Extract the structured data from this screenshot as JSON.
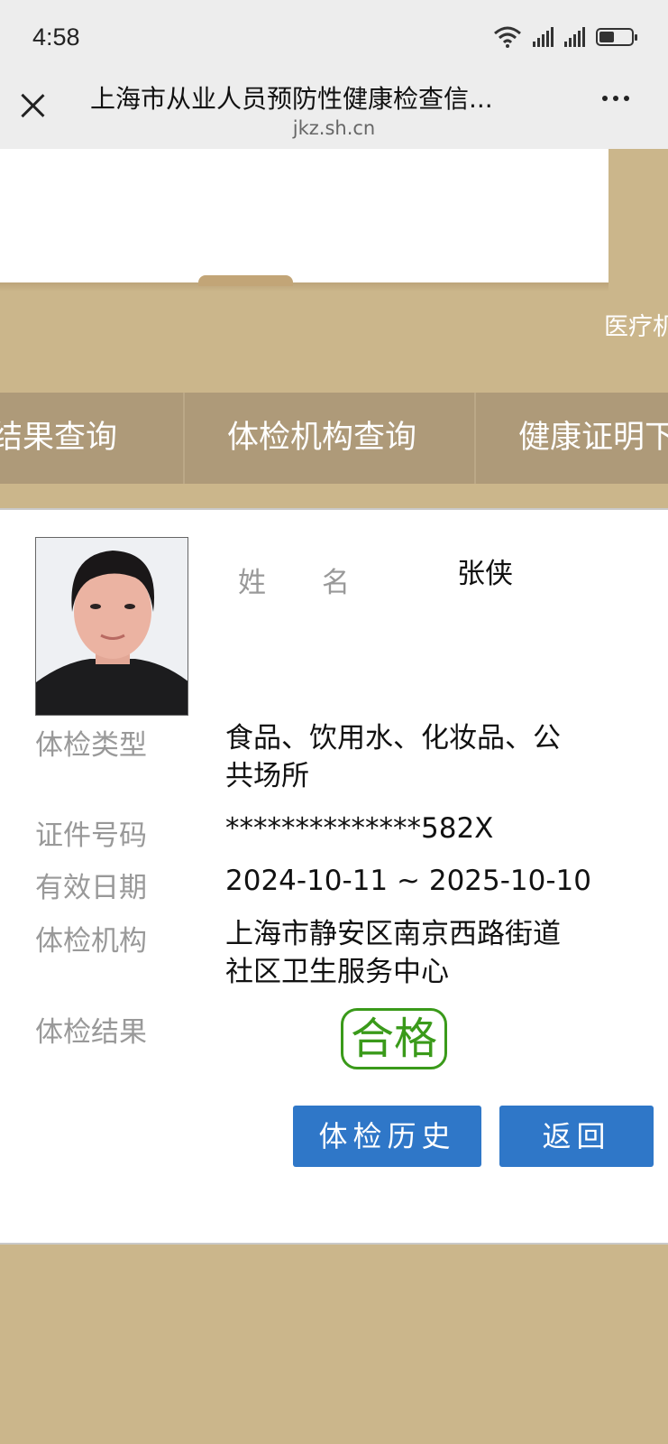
{
  "status_bar": {
    "time": "4:58"
  },
  "header": {
    "title": "上海市从业人员预防性健康检查信...",
    "url": "jkz.sh.cn"
  },
  "banner": {
    "text": "医疗机"
  },
  "nav": {
    "items": [
      "结果查询",
      "体检机构查询",
      "健康证明下"
    ]
  },
  "record": {
    "name_label": "姓　　名",
    "name_value": "张侠",
    "type_label": "体检类型",
    "type_value_line1": "食品、饮用水、化妆品、公",
    "type_value_line2": "共场所",
    "id_label": "证件号码",
    "id_value": "**************582X",
    "validity_label": "有效日期",
    "validity_value": "2024-10-11 ~ 2025-10-10",
    "org_label": "体检机构",
    "org_value_line1": "上海市静安区南京西路街道",
    "org_value_line2": "社区卫生服务中心",
    "result_label": "体检结果",
    "result_value": "合格"
  },
  "buttons": {
    "history": "体检历史",
    "back": "返回"
  },
  "colors": {
    "gold": "#cbb68b",
    "nav": "#ae9a79",
    "button": "#2f77c8",
    "stamp": "#3a9a1a"
  }
}
